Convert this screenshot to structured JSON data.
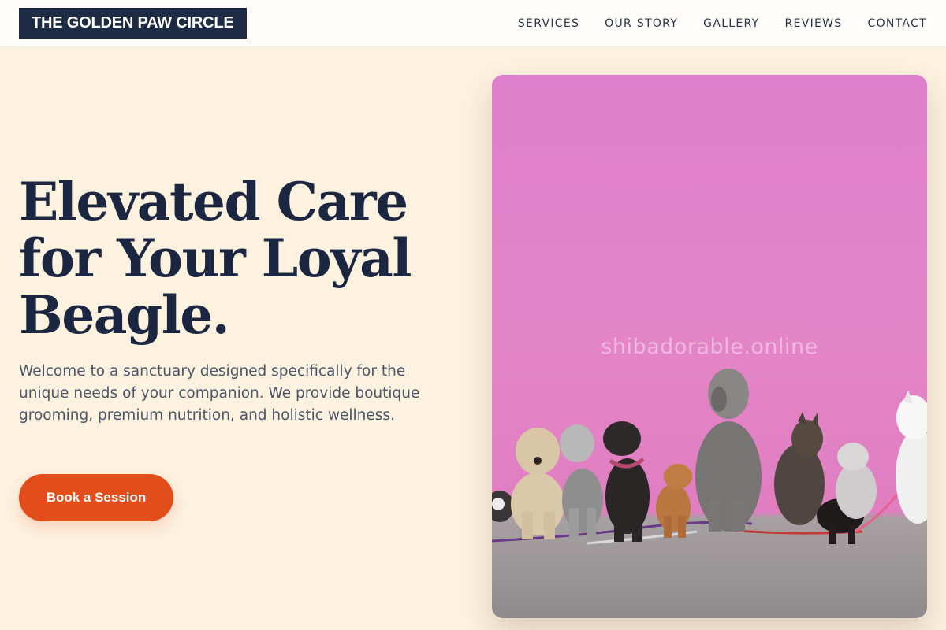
{
  "brand": {
    "name": "THE GOLDEN PAW CIRCLE"
  },
  "nav": {
    "items": [
      {
        "label": "SERVICES"
      },
      {
        "label": "OUR STORY"
      },
      {
        "label": "GALLERY"
      },
      {
        "label": "REVIEWS"
      },
      {
        "label": "CONTACT"
      }
    ]
  },
  "hero": {
    "title_lines": [
      "Elevated Care",
      "for Your Loyal",
      "Beagle."
    ],
    "description": "Welcome to a sanctuary designed specifically for the unique needs of your companion. We provide boutique grooming, premium nutrition, and holistic wellness.",
    "cta_label": "Book a Session",
    "image_watermark": "shibadorable.online"
  },
  "colors": {
    "page_background": "#fdf1e0",
    "header_background": "#fffdfa",
    "logo_background": "#1d2b45",
    "headline": "#1b2740",
    "body_text": "#4a5568",
    "cta": "#e24e1b",
    "photo_wall": "#e381c9",
    "photo_ground": "#9a9696"
  }
}
